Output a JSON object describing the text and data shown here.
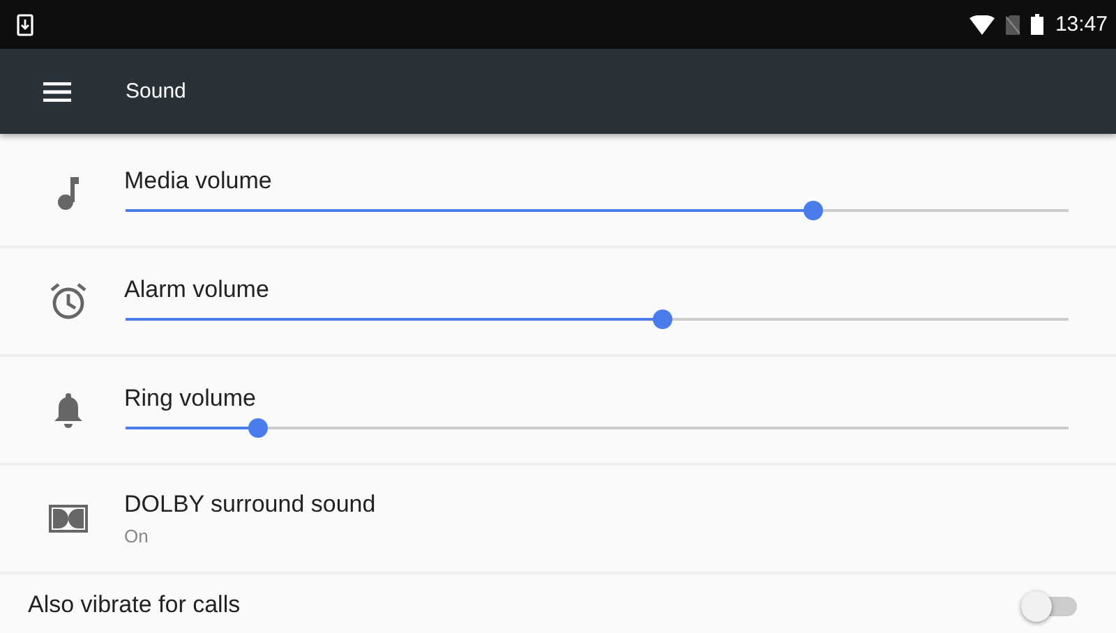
{
  "status_bar": {
    "time": "13:47"
  },
  "toolbar": {
    "title": "Sound"
  },
  "settings": [
    {
      "kind": "slider",
      "label": "Media volume",
      "level": 0.73
    },
    {
      "kind": "slider",
      "label": "Alarm volume",
      "level": 0.57
    },
    {
      "kind": "slider",
      "label": "Ring volume",
      "level": 0.14
    },
    {
      "kind": "text",
      "label": "DOLBY surround sound",
      "summary": "On"
    },
    {
      "kind": "switch",
      "label": "Also vibrate for calls",
      "on": false
    }
  ]
}
